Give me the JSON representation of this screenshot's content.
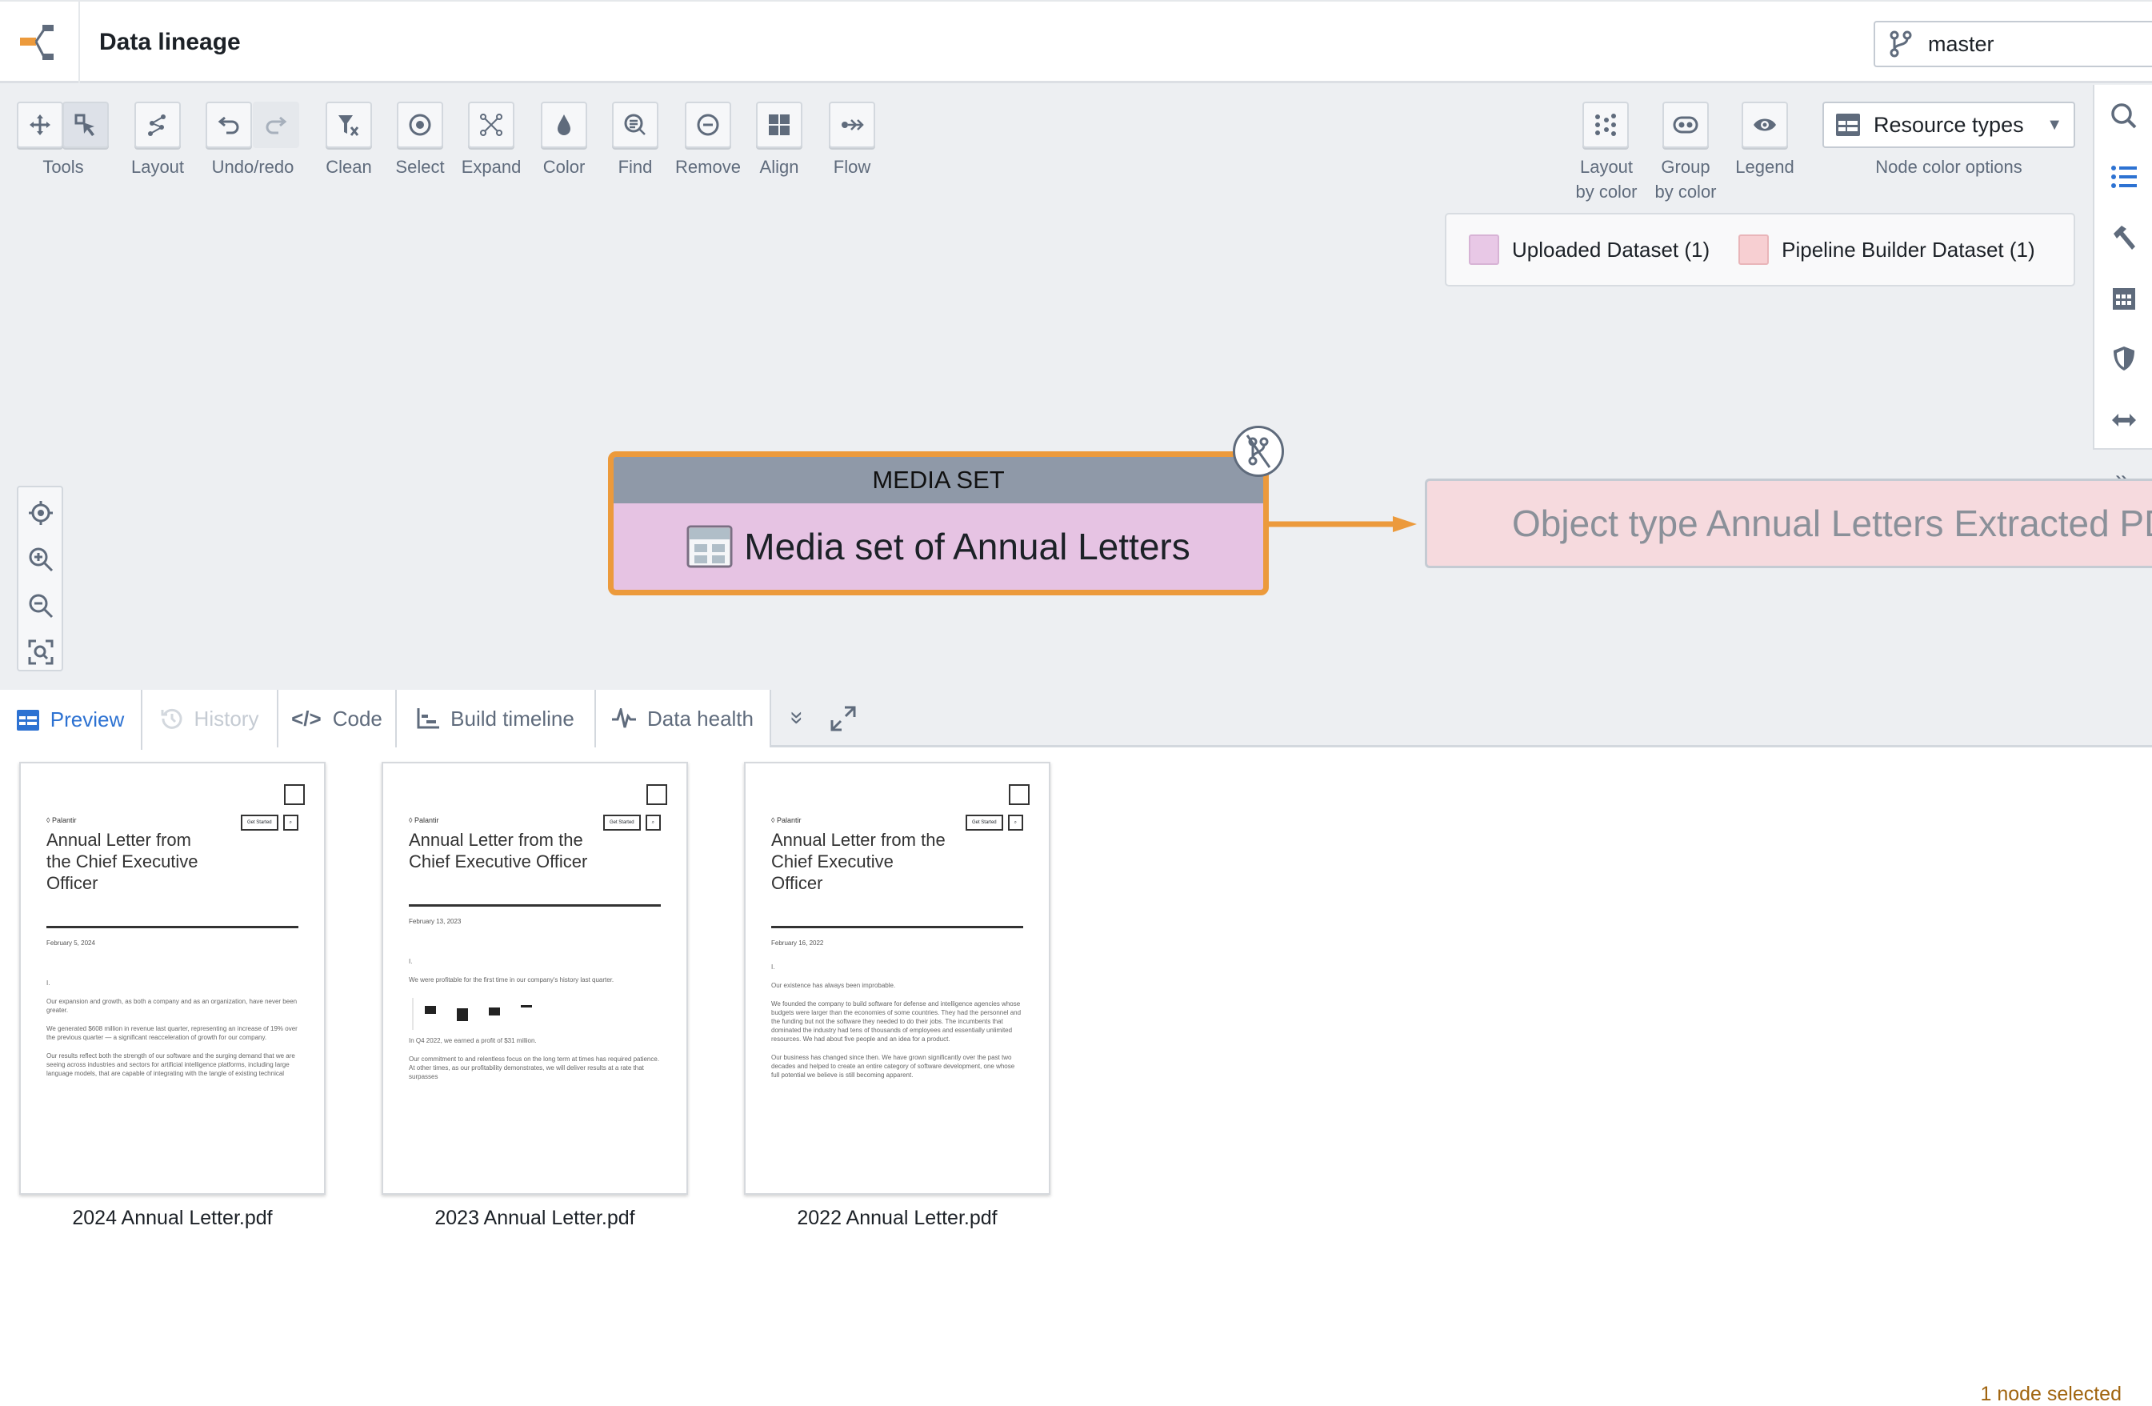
{
  "header": {
    "title": "Data lineage",
    "branch": "master"
  },
  "toolbar": {
    "items": [
      {
        "label": "Tools"
      },
      {
        "label": "Layout"
      },
      {
        "label": "Undo/redo"
      },
      {
        "label": "Clean"
      },
      {
        "label": "Select"
      },
      {
        "label": "Expand"
      },
      {
        "label": "Color"
      },
      {
        "label": "Find"
      },
      {
        "label": "Remove"
      },
      {
        "label": "Align"
      },
      {
        "label": "Flow"
      }
    ],
    "right": {
      "layout_by_color": [
        "Layout",
        "by color"
      ],
      "group_by_color": [
        "Group",
        "by color"
      ],
      "legend": "Legend",
      "node_color_select": "Resource types",
      "node_color_label": "Node color options"
    }
  },
  "legend": {
    "items": [
      {
        "label": "Uploaded Dataset (1)",
        "color": "#e8c8e6"
      },
      {
        "label": "Pipeline Builder Dataset (1)",
        "color": "#f7cfd2"
      }
    ]
  },
  "graph": {
    "selected_node": {
      "type": "MEDIA SET",
      "name": "Media set of Annual Letters",
      "border_color": "#ec9a3c",
      "fill": "#e6c3e3"
    },
    "downstream_node": {
      "name": "Object type Annual Letters Extracted PDFs",
      "fill": "#f6dade"
    }
  },
  "bottom_panel": {
    "tabs": [
      {
        "label": "Preview",
        "state": "selected"
      },
      {
        "label": "History",
        "state": "disabled"
      },
      {
        "label": "Code"
      },
      {
        "label": "Build timeline"
      },
      {
        "label": "Data health"
      }
    ],
    "status": "1 node selected",
    "files": [
      {
        "name": "2024 Annual Letter.pdf",
        "title": "Annual Letter from the Chief Executive Officer",
        "title_lines": [
          "Annual Letter from",
          "the Chief Executive",
          "Officer"
        ],
        "date": "February 5, 2024",
        "body": [
          "I.",
          "Our expansion and growth, as both a company and as an organization, have never been greater.",
          "We generated $608 million in revenue last quarter, representing an increase of 19% over the previous quarter — a significant reacceleration of growth for our company.",
          "Our results reflect both the strength of our software and the surging demand that we are seeing across industries and sectors for artificial intelligence platforms, including large language models, that are capable of integrating with the tangle of existing technical"
        ]
      },
      {
        "name": "2023 Annual Letter.pdf",
        "title": "Annual Letter from the Chief Executive Officer",
        "title_lines": [
          "Annual Letter from the",
          "Chief Executive Officer"
        ],
        "date": "February 13, 2023",
        "body": [
          "I.",
          "We were profitable for the first time in our company's history last quarter.",
          "In Q4 2022, we earned a profit of $31 million.",
          "Our commitment to and relentless focus on the long term at times has required patience. At other times, as our profitability demonstrates, we will deliver results at a rate that surpasses"
        ]
      },
      {
        "name": "2022 Annual Letter.pdf",
        "title": "Annual Letter from the Chief Executive Officer",
        "title_lines": [
          "Annual Letter from the",
          "Chief Executive",
          "Officer"
        ],
        "date": "February 16, 2022",
        "body": [
          "I.",
          "Our existence has always been improbable.",
          "We founded the company to build software for defense and intelligence agencies whose budgets were larger than the economies of some countries. They had the personnel and the funding but not the software they needed to do their jobs. The incumbents that dominated the industry had tens of thousands of employees and essentially unlimited resources. We had about five people and an idea for a product.",
          "Our business has changed since then. We have grown significantly over the past two decades and helped to create an entire category of software development, one whose full potential we believe is still becoming apparent."
        ]
      }
    ]
  }
}
